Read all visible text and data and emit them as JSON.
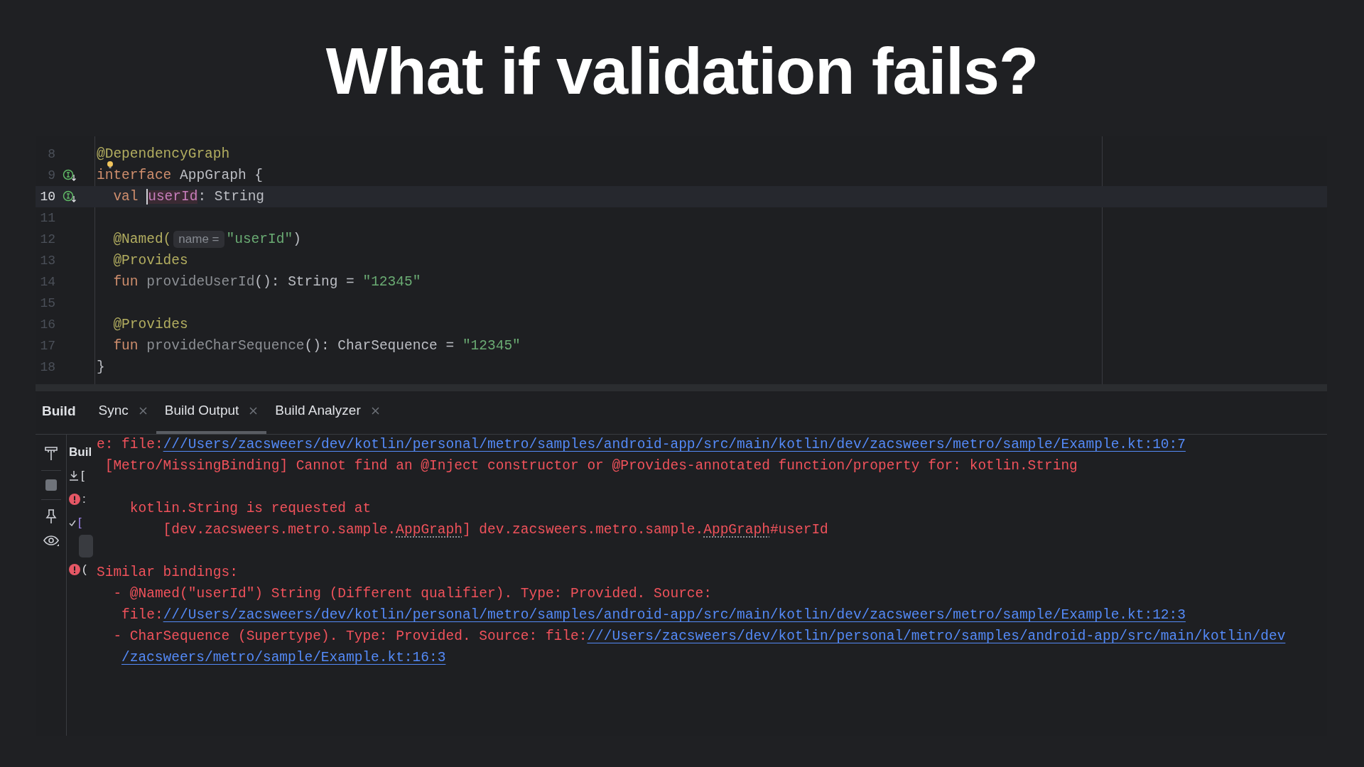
{
  "title": "What if validation fails?",
  "editor": {
    "lines": [
      {
        "number": "8",
        "current": false,
        "gutter_icon": false,
        "bulb": false,
        "tokens": [
          {
            "kind": "annotation",
            "text": "@DependencyGraph"
          }
        ]
      },
      {
        "number": "9",
        "current": false,
        "gutter_icon": true,
        "bulb": true,
        "tokens": [
          {
            "kind": "keyword",
            "text": "interface"
          },
          {
            "kind": "plain",
            "text": " AppGraph {"
          }
        ]
      },
      {
        "number": "10",
        "current": true,
        "gutter_icon": true,
        "bulb": false,
        "tokens": [
          {
            "kind": "keyword",
            "text": "  val "
          },
          {
            "kind": "property",
            "text": "userId",
            "caret": true
          },
          {
            "kind": "plain",
            "text": ": String"
          }
        ]
      },
      {
        "number": "11",
        "current": false,
        "gutter_icon": false,
        "bulb": false
      },
      {
        "number": "12",
        "current": false,
        "gutter_icon": false,
        "bulb": false,
        "tokens": [
          {
            "kind": "annotation",
            "text": "  @Named("
          },
          {
            "kind": "hint",
            "text": "name ="
          },
          {
            "kind": "string",
            "text": "\"userId\""
          },
          {
            "kind": "plain",
            "text": ")"
          }
        ]
      },
      {
        "number": "13",
        "current": false,
        "gutter_icon": false,
        "bulb": false,
        "tokens": [
          {
            "kind": "annotation",
            "text": "  @Provides"
          }
        ]
      },
      {
        "number": "14",
        "current": false,
        "gutter_icon": false,
        "bulb": false,
        "tokens": [
          {
            "kind": "keyword",
            "text": "  fun "
          },
          {
            "kind": "unused",
            "text": "provideUserId"
          },
          {
            "kind": "plain",
            "text": "(): String = "
          },
          {
            "kind": "string",
            "text": "\"12345\""
          }
        ]
      },
      {
        "number": "15",
        "current": false,
        "gutter_icon": false,
        "bulb": false
      },
      {
        "number": "16",
        "current": false,
        "gutter_icon": false,
        "bulb": false,
        "tokens": [
          {
            "kind": "annotation",
            "text": "  @Provides"
          }
        ]
      },
      {
        "number": "17",
        "current": false,
        "gutter_icon": false,
        "bulb": false,
        "tokens": [
          {
            "kind": "keyword",
            "text": "  fun "
          },
          {
            "kind": "unused",
            "text": "provideCharSequence"
          },
          {
            "kind": "plain",
            "text": "(): CharSequence = "
          },
          {
            "kind": "string",
            "text": "\"12345\""
          }
        ]
      },
      {
        "number": "18",
        "current": false,
        "gutter_icon": false,
        "bulb": false,
        "tokens": [
          {
            "kind": "plain",
            "text": "}"
          }
        ]
      }
    ]
  },
  "build_panel": {
    "title": "Build",
    "tabs": [
      {
        "label": "Sync",
        "selected": false,
        "closable": true
      },
      {
        "label": "Build Output",
        "selected": true,
        "closable": true
      },
      {
        "label": "Build Analyzer",
        "selected": false,
        "closable": true
      }
    ],
    "tree": [
      {
        "kind": "plain",
        "text": "Buil"
      },
      {
        "kind": "download",
        "text": "["
      },
      {
        "kind": "error",
        "text": ":"
      },
      {
        "kind": "check",
        "text": "["
      },
      {
        "kind": "selected"
      },
      {
        "kind": "error",
        "text": "("
      }
    ],
    "output": [
      {
        "kind": "line",
        "segments": [
          {
            "kind": "text",
            "text": "e: file:"
          },
          {
            "kind": "link",
            "text": "///Users/zacsweers/dev/kotlin/personal/metro/samples/android-app/src/main/kotlin/dev/zacsweers/metro/sample/Example.kt:10:7"
          }
        ]
      },
      {
        "kind": "line",
        "segments": [
          {
            "kind": "text",
            "text": " [Metro/MissingBinding] Cannot find an @Inject constructor or @Provides-annotated function/property for: kotlin.String"
          }
        ]
      },
      {
        "kind": "blank"
      },
      {
        "kind": "line",
        "segments": [
          {
            "kind": "text",
            "text": "    kotlin.String is requested at"
          }
        ]
      },
      {
        "kind": "line",
        "segments": [
          {
            "kind": "text",
            "text": "        [dev.zacsweers.metro.sample."
          },
          {
            "kind": "dotted",
            "text": "AppGraph"
          },
          {
            "kind": "text",
            "text": "] dev.zacsweers.metro.sample."
          },
          {
            "kind": "dotted",
            "text": "AppGraph"
          },
          {
            "kind": "text",
            "text": "#userId"
          }
        ]
      },
      {
        "kind": "blank"
      },
      {
        "kind": "line",
        "segments": [
          {
            "kind": "text",
            "text": "Similar bindings:"
          }
        ]
      },
      {
        "kind": "line",
        "segments": [
          {
            "kind": "text",
            "text": "  - @Named(\"userId\") String (Different qualifier). Type: Provided. Source:"
          }
        ]
      },
      {
        "kind": "line",
        "segments": [
          {
            "kind": "text",
            "text": "   file:"
          },
          {
            "kind": "link",
            "text": "///Users/zacsweers/dev/kotlin/personal/metro/samples/android-app/src/main/kotlin/dev/zacsweers/metro/sample/Example.kt:12:3"
          }
        ]
      },
      {
        "kind": "line",
        "segments": [
          {
            "kind": "text",
            "text": "  - CharSequence (Supertype). Type: Provided. Source: file:"
          },
          {
            "kind": "link",
            "text": "///Users/zacsweers/dev/kotlin/personal/metro/samples/android-app/src/main/kotlin/dev"
          }
        ]
      },
      {
        "kind": "continuation",
        "segments": [
          {
            "kind": "link",
            "text": "/zacsweers/metro/sample/Example.kt:16:3"
          }
        ]
      }
    ]
  }
}
